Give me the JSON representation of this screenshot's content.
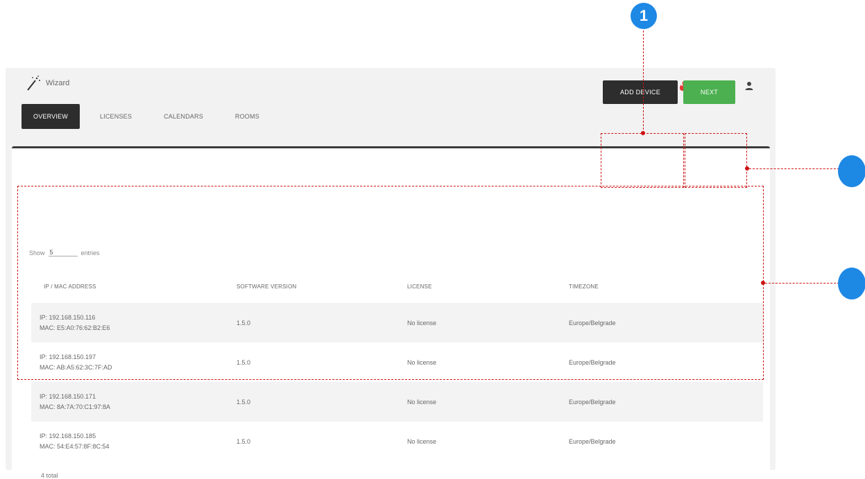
{
  "app": {
    "name": "Wizard"
  },
  "header": {
    "icons": [
      "flame-icon",
      "download-icon",
      "gear-icon",
      "user-icon"
    ]
  },
  "nav": {
    "tabs": [
      {
        "label": "OVERVIEW",
        "active": true
      },
      {
        "label": "LICENSES",
        "active": false
      },
      {
        "label": "CALENDARS",
        "active": false
      },
      {
        "label": "ROOMS",
        "active": false
      }
    ]
  },
  "toolbar": {
    "add_device_label": "ADD DEVICE",
    "next_label": "NEXT"
  },
  "show_entries": {
    "prefix": "Show",
    "value": "5",
    "suffix": "entries"
  },
  "table": {
    "headers": [
      "IP / MAC ADDRESS",
      "SOFTWARE VERSION",
      "LICENSE",
      "TIMEZONE"
    ],
    "rows": [
      {
        "ip": "IP: 192.168.150.116",
        "mac": "MAC: E5:A0:76:62:B2:E6",
        "version": "1.5.0",
        "license": "No license",
        "timezone": "Europe/Belgrade"
      },
      {
        "ip": "IP: 192.168.150.197",
        "mac": "MAC: AB:A5:62:3C:7F:AD",
        "version": "1.5.0",
        "license": "No license",
        "timezone": "Europe/Belgrade"
      },
      {
        "ip": "IP: 192.168.150.171",
        "mac": "MAC: 8A:7A:70:C1:97:8A",
        "version": "1.5.0",
        "license": "No license",
        "timezone": "Europe/Belgrade"
      },
      {
        "ip": "IP: 192.168.150.185",
        "mac": "MAC: 54:E4:57:8F:8C:54",
        "version": "1.5.0",
        "license": "No license",
        "timezone": "Europe/Belgrade"
      }
    ]
  },
  "footer": {
    "total": "4 total"
  },
  "annotations": {
    "marker_1": "1"
  },
  "colors": {
    "accent_green": "#4cb050",
    "dark": "#2d2d2d",
    "annotation_red": "#cc1111",
    "marker_blue": "#1e88e5",
    "flame_red": "#e53935"
  }
}
